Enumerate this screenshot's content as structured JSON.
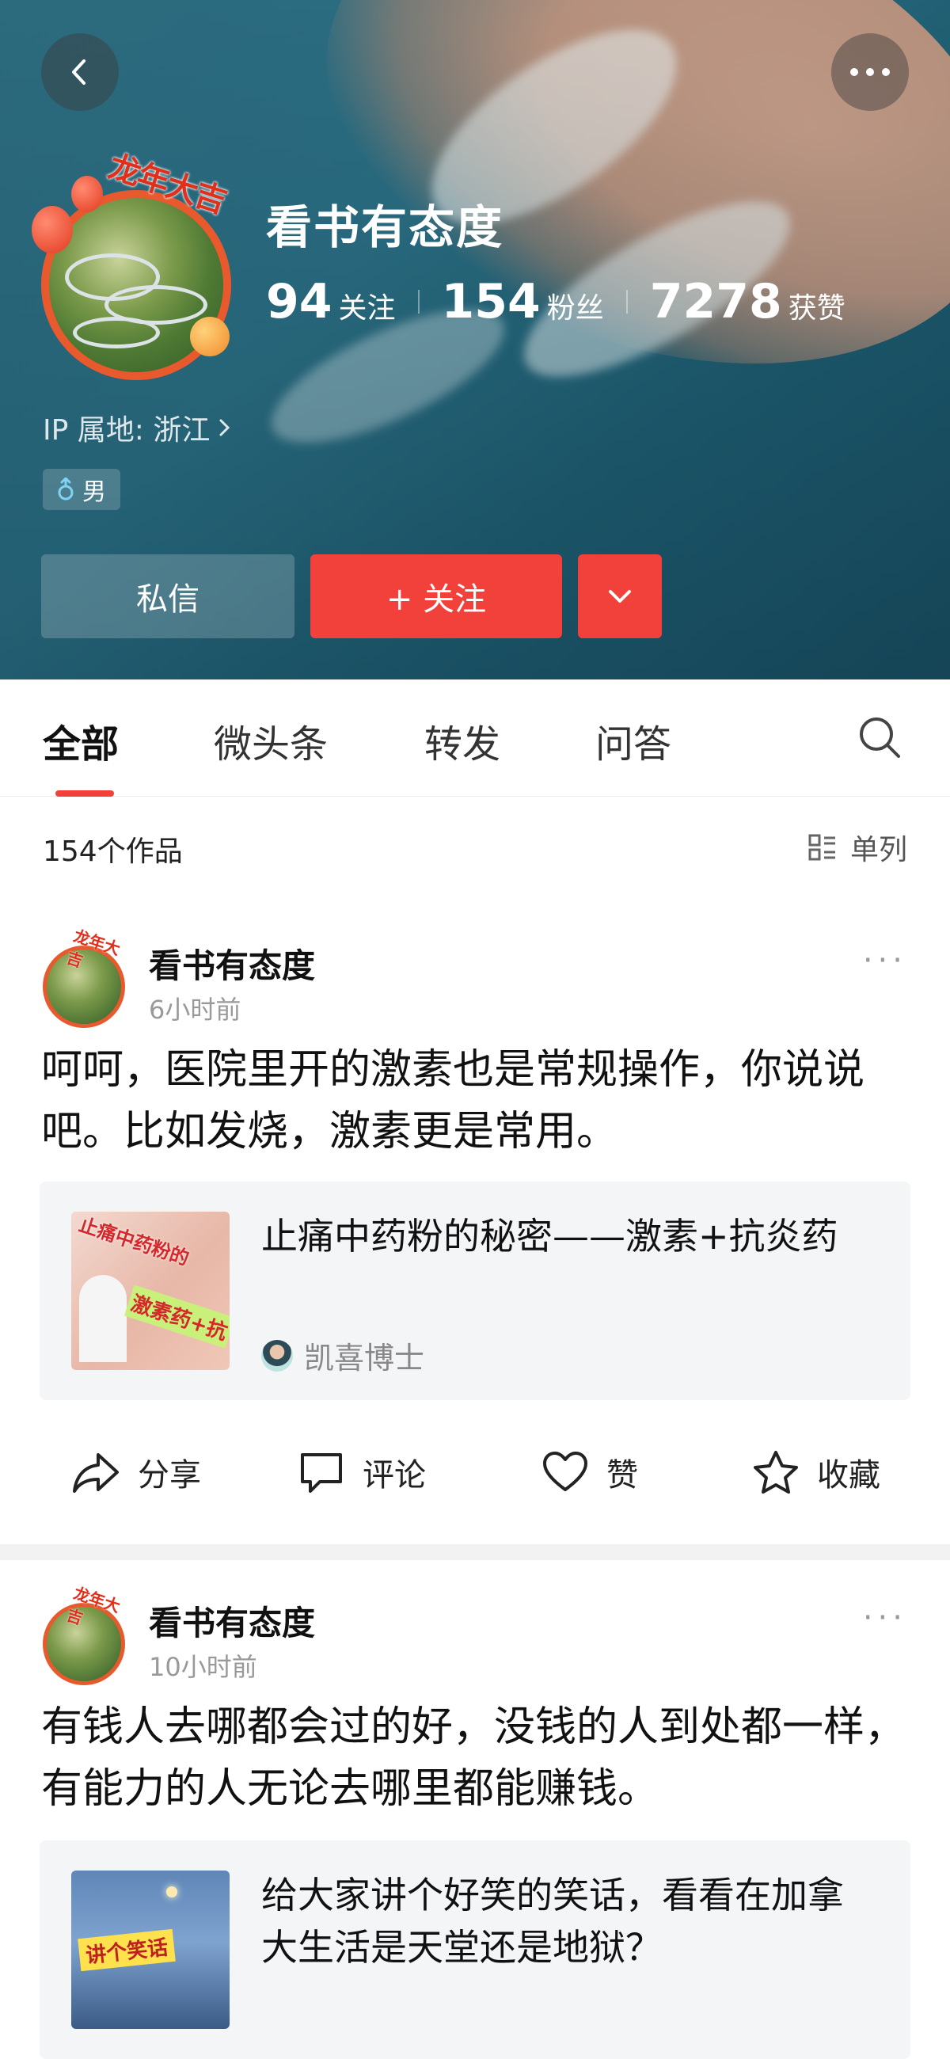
{
  "profile": {
    "badge_text": "龙年大吉",
    "name": "看书有态度",
    "stats": [
      {
        "value": "94",
        "label": "关注"
      },
      {
        "value": "154",
        "label": "粉丝"
      },
      {
        "value": "7278",
        "label": "获赞"
      }
    ],
    "ip_label": "IP 属地: 浙江",
    "gender": "男",
    "message_label": "私信",
    "follow_label": "+ 关注"
  },
  "tabs": [
    "全部",
    "微头条",
    "转发",
    "问答"
  ],
  "summary": {
    "count_text": "154个作品",
    "view_label": "单列"
  },
  "posts": [
    {
      "author": "看书有态度",
      "time": "6小时前",
      "text": "呵呵，医院里开的激素也是常规操作，你说说吧。比如发烧，激素更是常用。",
      "card": {
        "title": "止痛中药粉的秘密——激素+抗炎药",
        "author": "凯喜博士",
        "thumb_line1": "止痛中药粉的",
        "thumb_line2": "激素药+抗"
      }
    },
    {
      "author": "看书有态度",
      "time": "10小时前",
      "text": "有钱人去哪都会过的好，没钱的人到处都一样，有能力的人无论去哪里都能赚钱。",
      "card": {
        "title": "给大家讲个好笑的笑话，看看在加拿大生活是天堂还是地狱？",
        "thumb_line1": "讲个笑话"
      }
    }
  ],
  "actions": {
    "share": "分享",
    "comment": "评论",
    "like": "赞",
    "favorite": "收藏"
  },
  "colors": {
    "accent": "#f2413b",
    "header_teal": "#2b6f84"
  }
}
